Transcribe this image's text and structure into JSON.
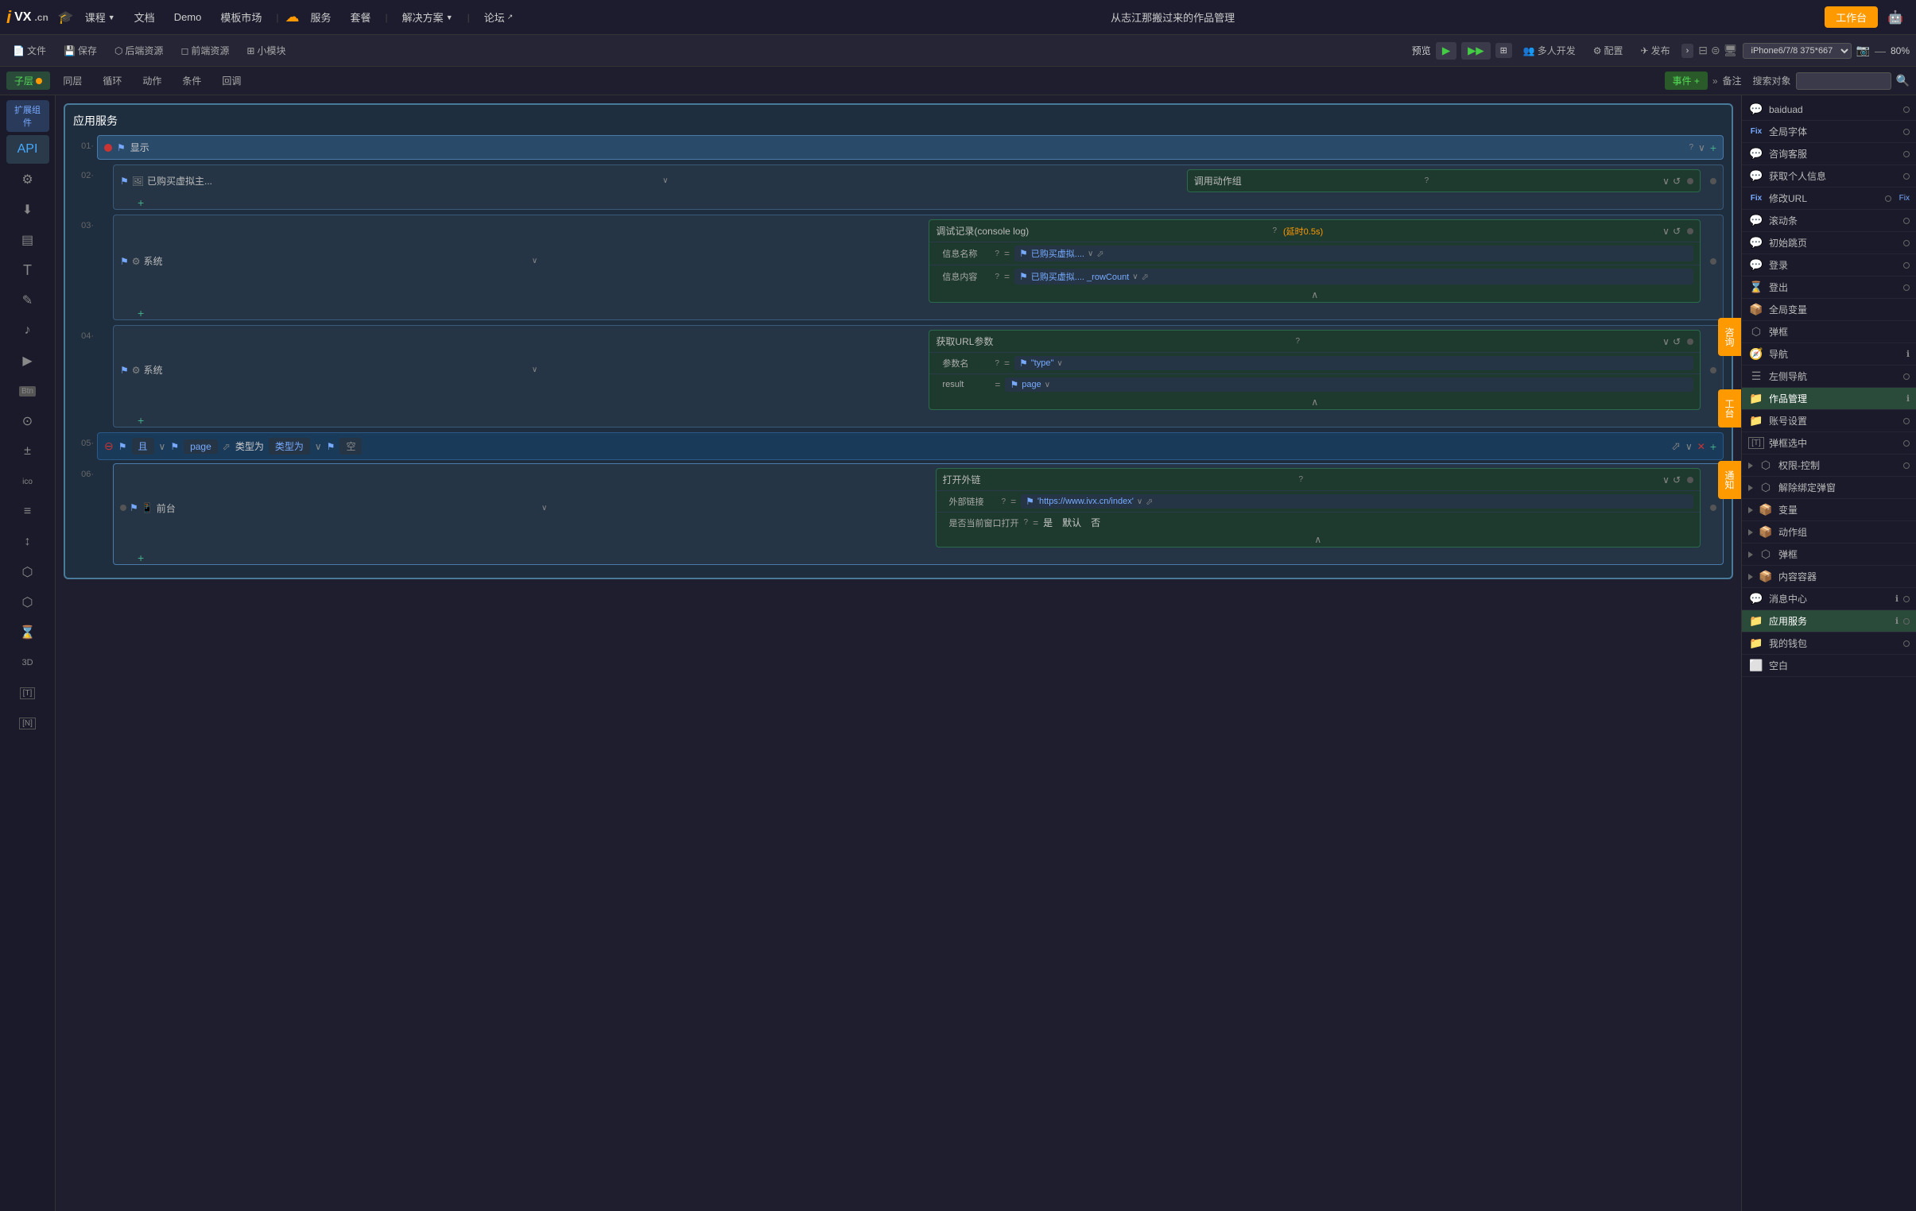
{
  "nav": {
    "logo_i": "i",
    "logo_vx": "VX",
    "logo_cn": ".cn",
    "items": [
      "课程",
      "文档",
      "Demo",
      "模板市场",
      "服务",
      "套餐",
      "解决方案",
      "论坛"
    ],
    "title": "从志江那搬过来的作品管理",
    "workbench": "工作台"
  },
  "toolbar2": {
    "items": [
      "文件",
      "保存",
      "后端资源",
      "前端资源",
      "小模块"
    ],
    "preview": "预览",
    "multi_dev": "多人开发",
    "config": "配置",
    "publish": "发布",
    "device": "iPhone6/7/8 375*667",
    "zoom": "80%"
  },
  "toolbar3": {
    "child_layer": "子层",
    "same_layer": "同层",
    "loop": "循环",
    "action": "动作",
    "condition": "条件",
    "review": "回调",
    "event_plus": "事件 +",
    "note": "备注",
    "search_placeholder": "搜索对象"
  },
  "canvas": {
    "app_service_title": "应用服务",
    "rows": [
      {
        "num": "01",
        "type": "display",
        "label": "显示",
        "has_help": true,
        "expandable": true
      },
      {
        "num": "02",
        "indent": true,
        "type": "purchased",
        "label": "已购买虚拟主...",
        "action_label": "调用动作组",
        "has_help": true
      },
      {
        "num": "03",
        "indent": true,
        "type": "system",
        "label": "系统",
        "action_label": "调试记录(console log)",
        "delay": "(延时0.5s)",
        "has_help": true,
        "fields": [
          {
            "label": "信息名称",
            "value": "已购买虚拟..."
          },
          {
            "label": "信息内容",
            "value": "已购买虚拟.... _rowCount"
          }
        ]
      },
      {
        "num": "04",
        "indent": true,
        "type": "system",
        "label": "系统",
        "action_label": "获取URL参数",
        "has_help": true,
        "fields": [
          {
            "label": "参数名",
            "value": "\"type\""
          },
          {
            "label": "result",
            "value": "page"
          }
        ]
      },
      {
        "num": "05",
        "type": "condition",
        "cond_op": "且",
        "cond_var": "page",
        "cond_type": "类型为",
        "cond_val": "空"
      },
      {
        "num": "06",
        "indent": true,
        "type": "frontend",
        "label": "前台",
        "action_label": "打开外链",
        "has_help": true,
        "fields": [
          {
            "label": "外部链接",
            "value": "'https://www.ivx.cn/index'"
          },
          {
            "label": "是否当前窗口打开",
            "value_prefix": "是",
            "value_default": "默认",
            "value_no": "否"
          }
        ]
      }
    ]
  },
  "right_panel": {
    "items": [
      {
        "label": "baiduad",
        "type": "msg",
        "has_circle": true
      },
      {
        "label": "全局字体",
        "type": "fix",
        "has_circle": true
      },
      {
        "label": "咨询客服",
        "type": "msg",
        "has_circle": true
      },
      {
        "label": "获取个人信息",
        "type": "msg",
        "has_circle": true
      },
      {
        "label": "修改URL",
        "type": "fix",
        "has_circle": true
      },
      {
        "label": "滚动条",
        "type": "msg",
        "has_circle": true
      },
      {
        "label": "初始跳页",
        "type": "msg",
        "has_circle": true
      },
      {
        "label": "登录",
        "type": "msg",
        "has_circle": true
      },
      {
        "label": "登出",
        "type": "msg",
        "has_circle": true
      },
      {
        "label": "全局变量",
        "type": "global",
        "has_circle": false
      },
      {
        "label": "弹框",
        "type": "popup",
        "has_circle": false
      },
      {
        "label": "导航",
        "type": "nav",
        "has_info": true
      },
      {
        "label": "左侧导航",
        "type": "left_nav",
        "has_circle": true
      },
      {
        "label": "作品管理",
        "type": "works",
        "has_info": true,
        "active": true
      },
      {
        "label": "账号设置",
        "type": "account",
        "has_circle": true
      },
      {
        "label": "弹框选中",
        "type": "t_popup",
        "has_circle": true
      },
      {
        "label": "权限-控制",
        "type": "group",
        "expandable": true
      },
      {
        "label": "解除绑定弹窗",
        "type": "group",
        "expandable": true
      },
      {
        "label": "变量",
        "type": "group",
        "expandable": true
      },
      {
        "label": "动作组",
        "type": "group",
        "expandable": true
      },
      {
        "label": "弹框",
        "type": "group",
        "expandable": true
      },
      {
        "label": "内容容器",
        "type": "group",
        "expandable": true
      },
      {
        "label": "消息中心",
        "type": "msg2",
        "has_info": true
      },
      {
        "label": "应用服务",
        "type": "app_service",
        "has_info": true,
        "active": true
      },
      {
        "label": "我的钱包",
        "type": "wallet",
        "has_circle": true
      },
      {
        "label": "空白",
        "type": "blank"
      }
    ]
  },
  "floating_btns": {
    "chat": "咨询",
    "workbench": "工台",
    "notify": "通知"
  },
  "left_sidebar": {
    "items": [
      {
        "icon": "API",
        "label": "API"
      },
      {
        "icon": "⚙",
        "label": ""
      },
      {
        "icon": "↓",
        "label": ""
      },
      {
        "icon": "▤",
        "label": ""
      },
      {
        "icon": "T",
        "label": ""
      },
      {
        "icon": "✎",
        "label": ""
      },
      {
        "icon": "♪",
        "label": ""
      },
      {
        "icon": "▶",
        "label": ""
      },
      {
        "icon": "Btn",
        "label": ""
      },
      {
        "icon": "⊙",
        "label": ""
      },
      {
        "icon": "±",
        "label": ""
      },
      {
        "icon": "ico",
        "label": ""
      },
      {
        "icon": "≡",
        "label": ""
      },
      {
        "icon": "↕",
        "label": ""
      },
      {
        "icon": "⬡",
        "label": ""
      },
      {
        "icon": "⌛",
        "label": ""
      },
      {
        "icon": "3D",
        "label": ""
      },
      {
        "icon": "T",
        "label": ""
      },
      {
        "icon": "N",
        "label": ""
      }
    ]
  }
}
